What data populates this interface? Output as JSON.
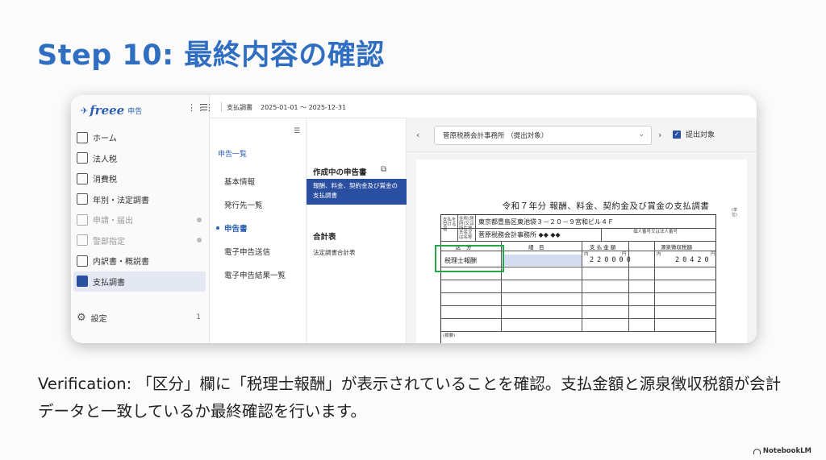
{
  "slide": {
    "title": "Step 10: 最終内容の確認",
    "caption": "Verification: 「区分」欄に「税理士報酬」が表示されていることを確認。支払金額と源泉徴収税額が会計データと一致しているか最終確認を行います。",
    "footer_brand": "NotebookLM"
  },
  "app": {
    "logo_text": "freee",
    "logo_sub": "申告",
    "sidebar": {
      "items": [
        {
          "label": "ホーム",
          "icon": "home-icon",
          "state": "normal"
        },
        {
          "label": "法人税",
          "icon": "corporate-tax-icon",
          "state": "normal"
        },
        {
          "label": "消費税",
          "icon": "consumption-tax-icon",
          "state": "normal"
        },
        {
          "label": "年別・法定調書",
          "icon": "document-icon",
          "state": "normal"
        },
        {
          "label": "申請・届出",
          "icon": "application-icon",
          "state": "disabled"
        },
        {
          "label": "警部指定",
          "icon": "monitor-icon",
          "state": "disabled"
        },
        {
          "label": "内訳書・概説書",
          "icon": "report-icon",
          "state": "normal"
        },
        {
          "label": "支払調書",
          "icon": "payment-record-icon",
          "state": "active"
        }
      ],
      "settings_label": "設定",
      "settings_count": "1"
    },
    "period": {
      "label": "支払調書",
      "range": "2025-01-01 〜 2025-12-31"
    },
    "declaration_nav": {
      "heading": "申告一覧",
      "items": [
        {
          "label": "基本情報",
          "selected": false
        },
        {
          "label": "発行先一覧",
          "selected": false
        },
        {
          "label": "申告書",
          "selected": true
        },
        {
          "label": "電子申告送信",
          "selected": false
        },
        {
          "label": "電子申告結果一覧",
          "selected": false
        }
      ]
    },
    "documents": {
      "in_progress_heading": "作成中の申告書",
      "active_doc": "報酬、料金、契約金及び賞金の支払調書",
      "total_heading": "合計表",
      "total_item": "法定調書合計表"
    },
    "preview": {
      "selected_payee": "菅原税務会計事務所 （提出対象）",
      "submit_label": "提出対象",
      "submit_checked": true,
      "form": {
        "title": "令和７年分 報酬、料金、契約金及び賞金の支払調書",
        "address_label": "住所(居所)又は所在地",
        "address": "東京都豊島区東池袋３－２０－９宮和ビル４Ｆ",
        "name_label": "氏名又は名称",
        "name": "菅原税務会計事務所 ◆◆ ◆◆",
        "my_number_label": "個人番号又は法人番号",
        "col_headers": {
          "category": "区　分",
          "details": "細　目",
          "payment": "支 払 金 額",
          "withholding": "源泉徴収税額"
        },
        "category_value": "税理士報酬",
        "payment_amount": "220000",
        "withholding_amount": "20420",
        "remarks_label": "(摘要)",
        "unit_inner": "内",
        "unit_yen": "円"
      }
    }
  },
  "colors": {
    "title": "#2f6ec0",
    "accent": "#2b4fa0",
    "highlight_box": "#22a84a",
    "cell_highlight": "#d4dcf2"
  }
}
